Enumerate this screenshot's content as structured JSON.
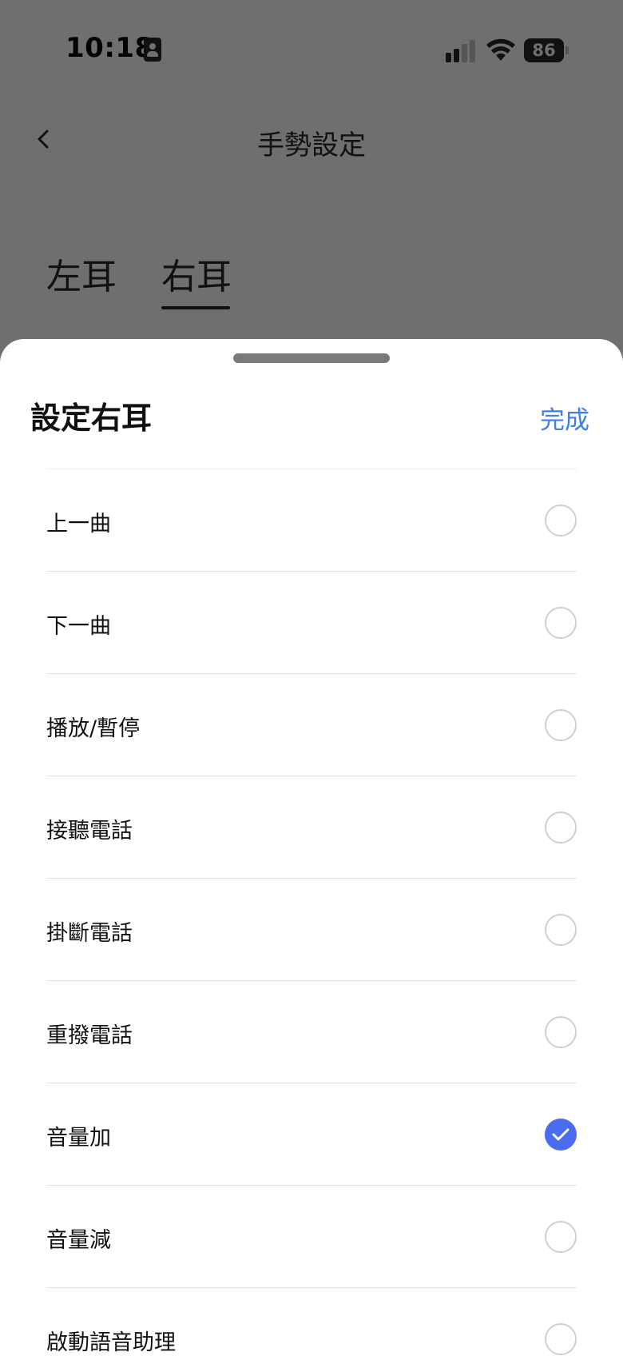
{
  "status_bar": {
    "time": "10:18",
    "battery_level": "86",
    "icons": [
      "id-card-icon",
      "cellular-signal-icon",
      "wifi-icon",
      "battery-icon"
    ]
  },
  "nav": {
    "title": "手勢設定",
    "back_icon": "chevron-left-icon"
  },
  "tabs": [
    {
      "label": "左耳",
      "selected": false
    },
    {
      "label": "右耳",
      "selected": true
    }
  ],
  "sheet": {
    "title": "設定右耳",
    "done_label": "完成",
    "options": [
      {
        "label": "上一曲",
        "selected": false
      },
      {
        "label": "下一曲",
        "selected": false
      },
      {
        "label": "播放/暫停",
        "selected": false
      },
      {
        "label": "接聽電話",
        "selected": false
      },
      {
        "label": "掛斷電話",
        "selected": false
      },
      {
        "label": "重撥電話",
        "selected": false
      },
      {
        "label": "音量加",
        "selected": true
      },
      {
        "label": "音量減",
        "selected": false
      },
      {
        "label": "啟動語音助理",
        "selected": false
      }
    ]
  },
  "colors": {
    "accent": "#4a6cf0",
    "link": "#3f7fea",
    "overlay": "#6f6f6f"
  }
}
